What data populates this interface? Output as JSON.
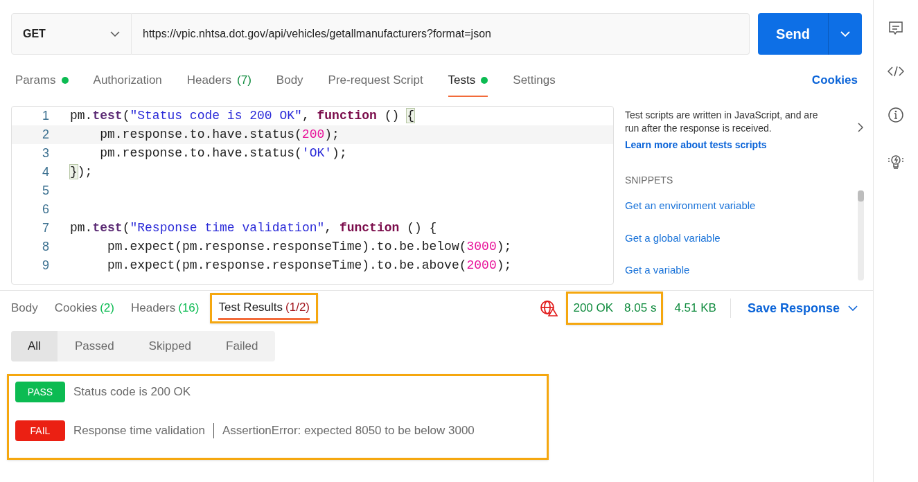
{
  "request": {
    "method": "GET",
    "url": "https://vpic.nhtsa.dot.gov/api/vehicles/getallmanufacturers?format=json",
    "send_label": "Send"
  },
  "request_tabs": [
    {
      "label": "Params",
      "dot": true,
      "selected": false
    },
    {
      "label": "Authorization",
      "dot": false,
      "selected": false
    },
    {
      "label": "Headers",
      "count": "(7)",
      "dot": false,
      "selected": false
    },
    {
      "label": "Body",
      "dot": false,
      "selected": false
    },
    {
      "label": "Pre-request Script",
      "dot": false,
      "selected": false
    },
    {
      "label": "Tests",
      "dot": true,
      "selected": true
    },
    {
      "label": "Settings",
      "dot": false,
      "selected": false
    }
  ],
  "cookies_link": "Cookies",
  "editor": {
    "lines": [
      {
        "number": "1",
        "tokens": [
          {
            "kind": "plain",
            "text": "pm."
          },
          {
            "kind": "fn",
            "text": "test"
          },
          {
            "kind": "plain",
            "text": "("
          },
          {
            "kind": "str",
            "text": "\"Status code is 200 OK\""
          },
          {
            "kind": "plain",
            "text": ", "
          },
          {
            "kind": "kw",
            "text": "function"
          },
          {
            "kind": "plain",
            "text": " () "
          },
          {
            "kind": "match",
            "text": "{"
          }
        ]
      },
      {
        "number": "2",
        "tokens": [
          {
            "kind": "plain",
            "text": "    pm.response.to.have.status("
          },
          {
            "kind": "num",
            "text": "200"
          },
          {
            "kind": "plain",
            "text": ");"
          }
        ]
      },
      {
        "number": "3",
        "tokens": [
          {
            "kind": "plain",
            "text": "    pm.response.to.have.status("
          },
          {
            "kind": "str",
            "text": "'OK'"
          },
          {
            "kind": "plain",
            "text": ");"
          }
        ]
      },
      {
        "number": "4",
        "tokens": [
          {
            "kind": "match",
            "text": "}"
          },
          {
            "kind": "plain",
            "text": ");"
          }
        ]
      },
      {
        "number": "5"
      },
      {
        "number": "6"
      },
      {
        "number": "7",
        "tokens": [
          {
            "kind": "plain",
            "text": "pm."
          },
          {
            "kind": "fn",
            "text": "test"
          },
          {
            "kind": "plain",
            "text": "("
          },
          {
            "kind": "str",
            "text": "\"Response time validation\""
          },
          {
            "kind": "plain",
            "text": ", "
          },
          {
            "kind": "kw",
            "text": "function"
          },
          {
            "kind": "plain",
            "text": " () {"
          }
        ]
      },
      {
        "number": "8",
        "tokens": [
          {
            "kind": "plain",
            "text": "     pm.expect(pm.response.responseTime).to.be.below("
          },
          {
            "kind": "num",
            "text": "3000"
          },
          {
            "kind": "plain",
            "text": ");"
          }
        ]
      },
      {
        "number": "9",
        "tokens": [
          {
            "kind": "plain",
            "text": "     pm.expect(pm.response.responseTime).to.be.above("
          },
          {
            "kind": "num",
            "text": "2000"
          },
          {
            "kind": "plain",
            "text": ");"
          }
        ]
      }
    ]
  },
  "help": {
    "description": "Test scripts are written in JavaScript, and are run after the response is received.",
    "learn_more": "Learn more about tests scripts",
    "snippets_heading": "SNIPPETS",
    "snippets": [
      "Get an environment variable",
      "Get a global variable",
      "Get a variable"
    ]
  },
  "response_tabs": [
    {
      "label": "Body",
      "selected": false
    },
    {
      "label": "Cookies",
      "count": "(2)",
      "color": "#0cbb52",
      "selected": false
    },
    {
      "label": "Headers",
      "count": "(16)",
      "color": "#0cbb52",
      "selected": false
    },
    {
      "label": "Test Results",
      "count": "(1/2)",
      "color": "#a3171e",
      "selected": true,
      "highlighted": true
    }
  ],
  "response_meta": {
    "status": "200 OK",
    "time": "8.05 s",
    "size": "4.51 KB",
    "save_label": "Save Response"
  },
  "filters": [
    {
      "label": "All",
      "selected": true
    },
    {
      "label": "Passed",
      "selected": false
    },
    {
      "label": "Skipped",
      "selected": false
    },
    {
      "label": "Failed",
      "selected": false
    }
  ],
  "results": [
    {
      "status": "PASS",
      "kind": "pass",
      "text": "Status code is 200 OK"
    },
    {
      "status": "FAIL",
      "kind": "fail",
      "name": "Response time validation",
      "text": "AssertionError: expected 8050 to be below 3000"
    }
  ]
}
